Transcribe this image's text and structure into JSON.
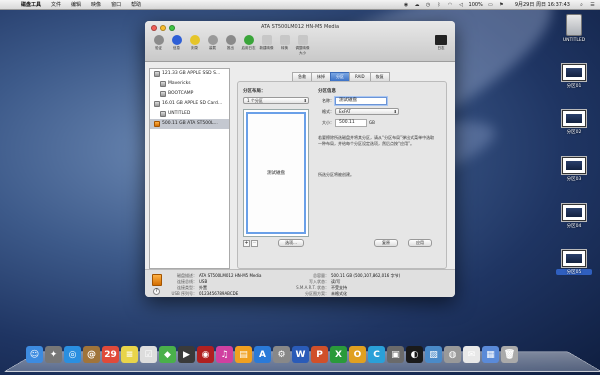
{
  "menubar": {
    "app_name": "磁盘工具",
    "items": [
      "文件",
      "编辑",
      "映像",
      "窗口",
      "帮助"
    ],
    "battery": "100%",
    "datetime": "9月29日 周日  16:37:43"
  },
  "desktop_icons": [
    {
      "label": "UNTITLED",
      "kind": "drive"
    },
    {
      "label": "分区01",
      "kind": "screen"
    },
    {
      "label": "分区02",
      "kind": "screen"
    },
    {
      "label": "分区03",
      "kind": "screen"
    },
    {
      "label": "分区04",
      "kind": "screen"
    },
    {
      "label": "分区05",
      "kind": "screen"
    }
  ],
  "window": {
    "title": "ATA ST500LM012 HN-M5 Media",
    "toolbar": [
      {
        "label": "验证",
        "icon": "microscope-icon",
        "color": "#8b8b8b"
      },
      {
        "label": "信息",
        "icon": "info-icon",
        "color": "#2e5fd6"
      },
      {
        "label": "刻录",
        "icon": "burn-icon",
        "color": "#e5c52a"
      },
      {
        "label": "装载",
        "icon": "mount-icon",
        "color": "#9a9a9a"
      },
      {
        "label": "推出",
        "icon": "eject-icon",
        "color": "#8a8a8a"
      },
      {
        "label": "启用日志",
        "icon": "journal-icon",
        "color": "#3aa53a"
      },
      {
        "label": "新建映像",
        "icon": "new-image-icon",
        "color": "#c7c7c7"
      },
      {
        "label": "转换",
        "icon": "convert-icon",
        "color": "#c7c7c7"
      },
      {
        "label": "调整映像大小",
        "icon": "resize-image-icon",
        "color": "#c7c7c7"
      }
    ],
    "log_label": "日志",
    "sidebar": [
      {
        "label": "121.33 GB APPLE SSD S...",
        "level": 0,
        "orange": false,
        "selected": false
      },
      {
        "label": "Mavericks",
        "level": 1,
        "orange": false,
        "selected": false
      },
      {
        "label": "BOOTCAMP",
        "level": 1,
        "orange": false,
        "selected": false
      },
      {
        "label": "16.01 GB APPLE SD Card...",
        "level": 0,
        "orange": false,
        "selected": false
      },
      {
        "label": "UNTITLED",
        "level": 1,
        "orange": false,
        "selected": false
      },
      {
        "label": "500.11 GB ATA ST500L...",
        "level": 0,
        "orange": true,
        "selected": true
      }
    ],
    "tabs": [
      {
        "label": "急救",
        "active": false
      },
      {
        "label": "抹掉",
        "active": false
      },
      {
        "label": "分区",
        "active": true
      },
      {
        "label": "RAID",
        "active": false
      },
      {
        "label": "恢复",
        "active": false
      }
    ],
    "partition": {
      "layout_heading": "分区布局：",
      "layout_select": "1 个分区",
      "partition_name": "测试磁盘",
      "info_heading": "分区信息",
      "name_label": "名称：",
      "name_value": "测试磁盘",
      "format_label": "格式：",
      "format_value": "ExFAT",
      "size_label": "大小：",
      "size_value": "500.11",
      "size_unit": "GB",
      "description": "若要擦除所选磁盘并将其分区，请从“分区布局”弹出式菜单中选取一种布局，并给每个分区设定选项，然后点按“应用”。",
      "status": "所选分区将被创建。",
      "plus": "+",
      "minus": "−",
      "options_button": "选项...",
      "revert_button": "复原",
      "apply_button": "应用"
    },
    "info": {
      "left": [
        {
          "k": "磁盘描述：",
          "v": "ATA ST500LM012 HN-M5 Media"
        },
        {
          "k": "连接总线：",
          "v": "USB"
        },
        {
          "k": "连接类型：",
          "v": "外置"
        },
        {
          "k": "USB 序列号：",
          "v": "0123456789ABCDE"
        }
      ],
      "right": [
        {
          "k": "总容量：",
          "v": "500.11 GB (500,107,862,016 字节)"
        },
        {
          "k": "写入状态：",
          "v": "读/写"
        },
        {
          "k": "S.M.A.R.T. 状态：",
          "v": "不受支持"
        },
        {
          "k": "分区图方案：",
          "v": "未格式化"
        }
      ],
      "help": "?"
    }
  },
  "dock": [
    {
      "name": "finder-icon",
      "glyph": "☺",
      "color": "#3d8be0"
    },
    {
      "name": "launchpad-icon",
      "glyph": "✦",
      "color": "#777"
    },
    {
      "name": "safari-icon",
      "glyph": "◎",
      "color": "#2a8fe0"
    },
    {
      "name": "contacts-icon",
      "glyph": "@",
      "color": "#a0743a"
    },
    {
      "name": "calendar-icon",
      "glyph": "29",
      "color": "#e04a3a"
    },
    {
      "name": "notes-icon",
      "glyph": "≡",
      "color": "#e8d44a"
    },
    {
      "name": "reminders-icon",
      "glyph": "☑",
      "color": "#ddd"
    },
    {
      "name": "maps-icon",
      "glyph": "◆",
      "color": "#4ab04a"
    },
    {
      "name": "facetime-icon",
      "glyph": "▶",
      "color": "#3a3a3a"
    },
    {
      "name": "photobooth-icon",
      "glyph": "◉",
      "color": "#b02020"
    },
    {
      "name": "itunes-icon",
      "glyph": "♫",
      "color": "#d040a0"
    },
    {
      "name": "ibooks-icon",
      "glyph": "▤",
      "color": "#f0a020"
    },
    {
      "name": "appstore-icon",
      "glyph": "A",
      "color": "#2a7ad8"
    },
    {
      "name": "preferences-icon",
      "glyph": "⚙",
      "color": "#888"
    },
    {
      "name": "word-icon",
      "glyph": "W",
      "color": "#2a5bb8"
    },
    {
      "name": "powerpoint-icon",
      "glyph": "P",
      "color": "#d0502a"
    },
    {
      "name": "excel-icon",
      "glyph": "X",
      "color": "#2a9a3a"
    },
    {
      "name": "outlook-icon",
      "glyph": "O",
      "color": "#e0a020"
    },
    {
      "name": "lync-icon",
      "glyph": "C",
      "color": "#2aa0d8"
    },
    {
      "name": "vmware-icon",
      "glyph": "▣",
      "color": "#6a6a6a"
    },
    {
      "name": "qq-icon",
      "glyph": "◐",
      "color": "#1a1a1a"
    },
    {
      "name": "preview-icon",
      "glyph": "▨",
      "color": "#4a8ac8"
    },
    {
      "name": "diskutility-icon",
      "glyph": "◍",
      "color": "#999"
    },
    {
      "name": "stickies-icon",
      "glyph": "✉",
      "color": "#e8e8e8"
    },
    {
      "name": "documents-icon",
      "glyph": "▦",
      "color": "#5a8ad8"
    },
    {
      "name": "trash-icon",
      "glyph": "🗑",
      "color": "#aaaaaa"
    }
  ]
}
